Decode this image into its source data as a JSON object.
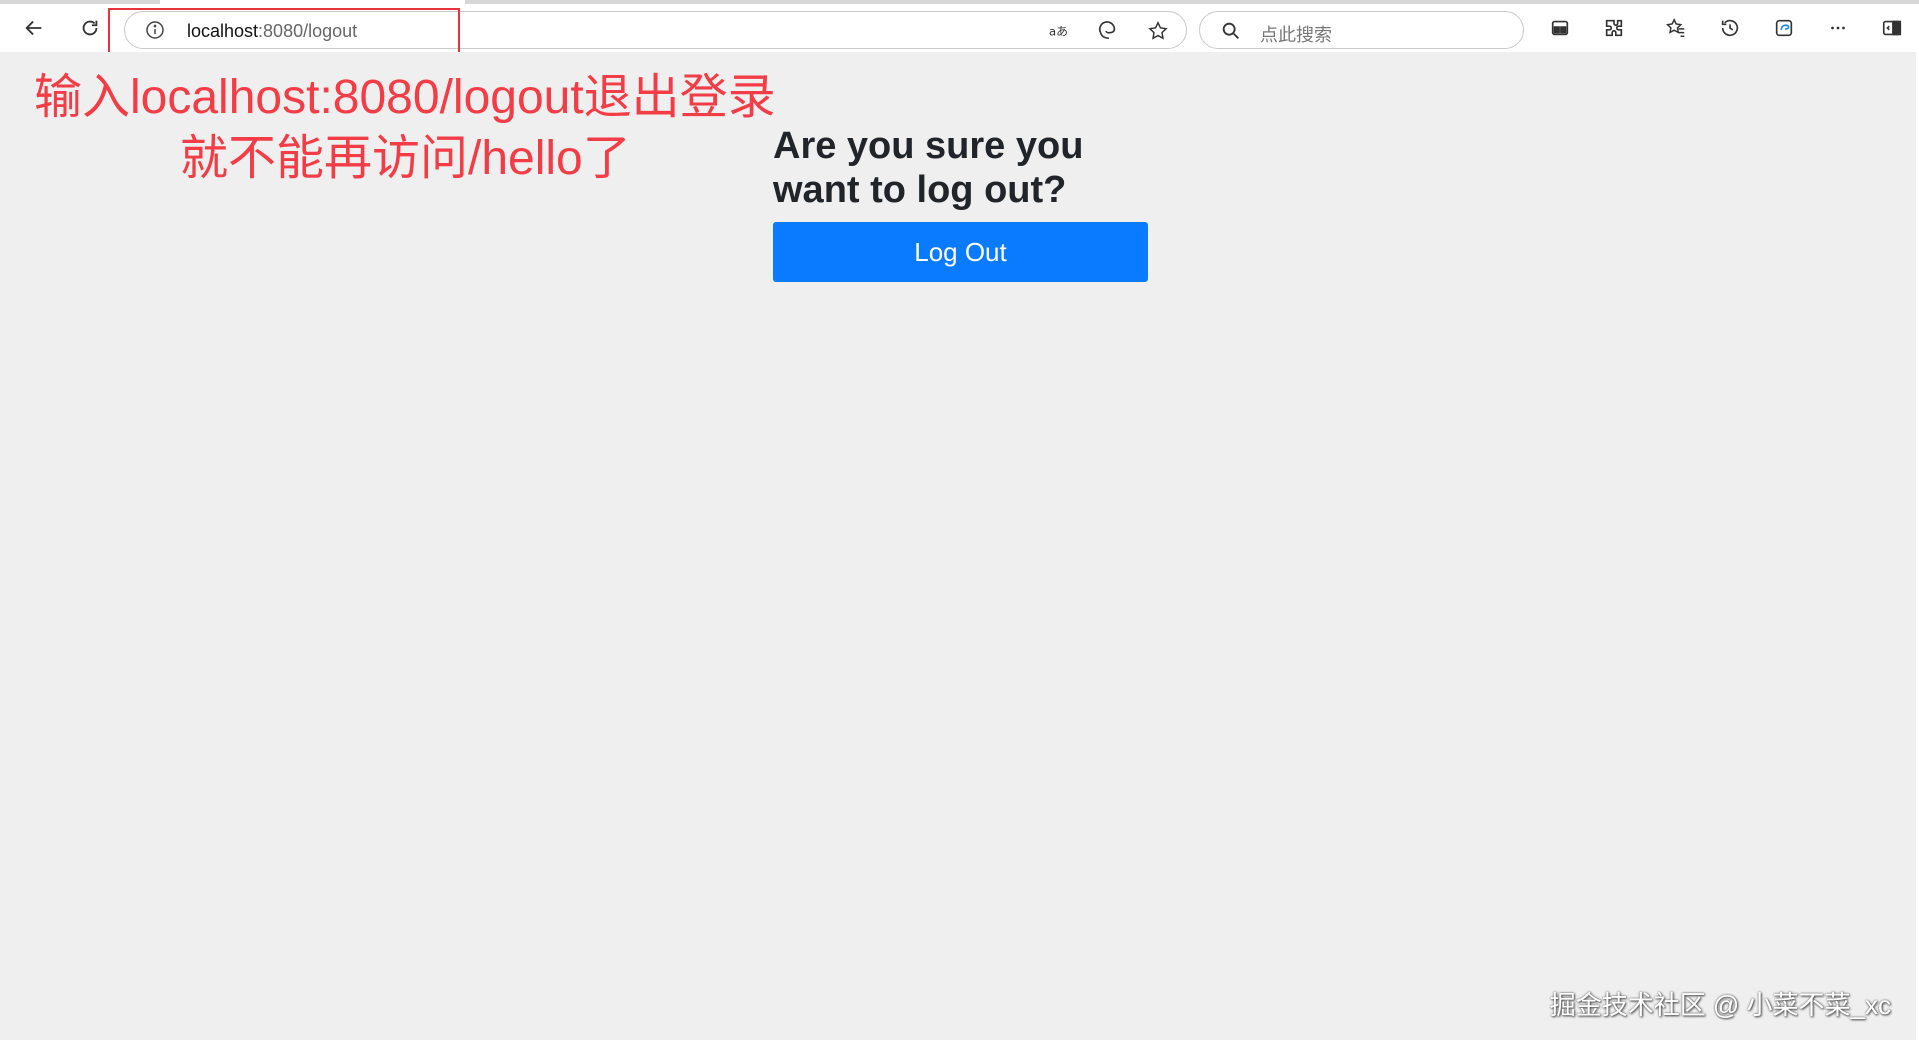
{
  "browser": {
    "url_host": "localhost",
    "url_rest": ":8080/logout",
    "search_placeholder": "点此搜索",
    "icons": {
      "back": "back-arrow-icon",
      "refresh": "refresh-icon",
      "info": "info-icon",
      "read_aloud": "read-aloud-icon",
      "edge": "edge-icon",
      "favorite": "star-icon",
      "search": "search-icon",
      "split": "split-screen-icon",
      "extensions": "extensions-icon",
      "favorites": "favorites-icon",
      "history": "history-icon",
      "collections": "collections-icon",
      "more": "more-icon",
      "sidebar": "sidebar-icon"
    }
  },
  "annotation": {
    "line1": "输入localhost:8080/logout退出登录",
    "line2": "就不能再访问/hello了",
    "color": "#f23c46"
  },
  "page": {
    "heading": "Are you sure you want to log out?",
    "button_label": "Log Out",
    "button_color": "#0a7bff",
    "background": "#efefef"
  },
  "watermark": "掘金技术社区 @ 小菜不菜_xc"
}
